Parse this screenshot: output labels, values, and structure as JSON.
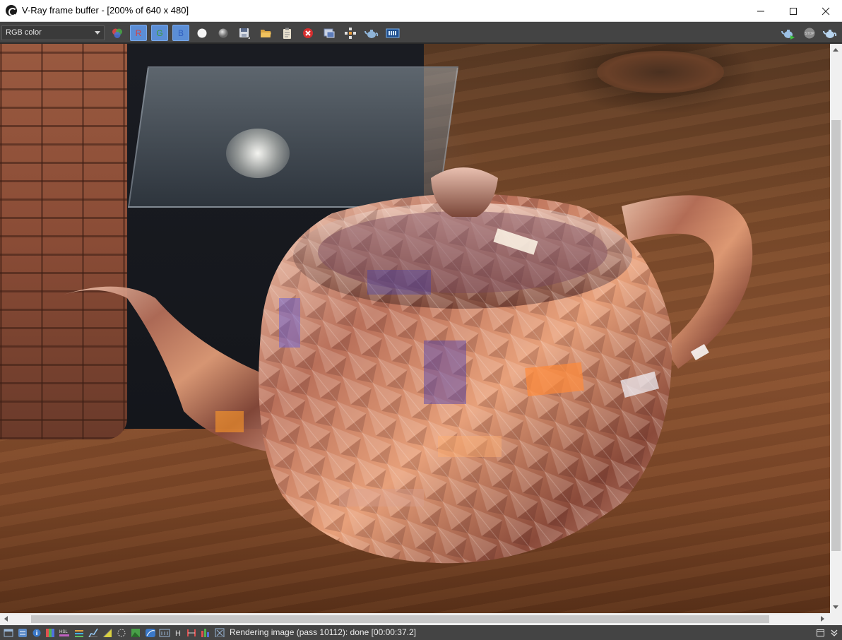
{
  "window": {
    "title": "V-Ray frame buffer - [200% of 640 x 480]",
    "controls": [
      "minimize",
      "maximize",
      "close"
    ]
  },
  "toolbar": {
    "channel": {
      "selected": "RGB color"
    },
    "channel_toggles": [
      {
        "label": "R",
        "color": "#e04040",
        "active": true
      },
      {
        "label": "G",
        "color": "#3c9a3c",
        "active": true
      },
      {
        "label": "B",
        "color": "#2f5fbf",
        "active": true
      }
    ],
    "buttons": [
      "color-channels-icon",
      "white-sphere-icon",
      "gray-sphere-icon",
      "save-image-icon",
      "open-image-icon",
      "copy-clipboard-icon",
      "clear-image-icon",
      "track-mouse-icon",
      "region-render-icon",
      "teapot-render-icon",
      "history-icon"
    ],
    "right_buttons": [
      "render-icon",
      "stop-icon",
      "teapot-last-render-icon"
    ],
    "stop_label": "STOP"
  },
  "viewport": {
    "content": "Rendered image of a faceted crystal teapot on a wooden floor"
  },
  "statusbar": {
    "icons": [
      "panel-icon",
      "settings-icon",
      "info-icon",
      "color-corrections-icon",
      "hsl-icon",
      "levels-icon",
      "curves-icon",
      "exposure-icon",
      "lut-icon",
      "background-icon",
      "compare-icon",
      "lens-effects-icon",
      "histogram-icon",
      "h-icon",
      "stereo-icon",
      "pixel-aspect-icon",
      "close-panel-icon"
    ],
    "h_label": "H",
    "hsl_label": "HSL",
    "text": "Rendering image (pass 10112): done [00:00:37.2]"
  }
}
